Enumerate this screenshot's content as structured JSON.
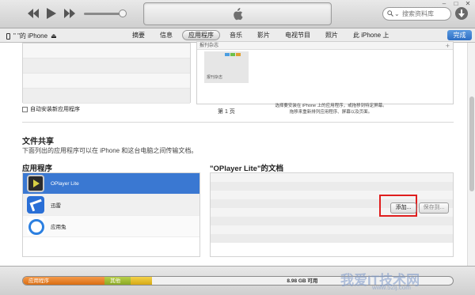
{
  "toolbar": {
    "search_placeholder": "搜索资料库"
  },
  "device_bar": {
    "device_name": "\"     \"的 iPhone",
    "tabs": [
      {
        "label": "摘要"
      },
      {
        "label": "信息"
      },
      {
        "label": "应用程序",
        "active": true
      },
      {
        "label": "音乐"
      },
      {
        "label": "影片"
      },
      {
        "label": "电视节目"
      },
      {
        "label": "照片"
      },
      {
        "label": "此 iPhone 上"
      }
    ],
    "done_label": "完成"
  },
  "apps_section": {
    "auto_install_label": "自动安装新应用程序",
    "panel_header": "报刊杂志",
    "thumb_label": "报刊杂志",
    "page_label": "第 1 页",
    "hint_line1": "选择要安装在 iPhone 上的应用程序，或拖移到特定屏幕。",
    "hint_line2": "拖移来重新排列应用程序、屏幕以及页面。"
  },
  "file_sharing": {
    "title": "文件共享",
    "description": "下面列出的应用程序可以在 iPhone 和这台电脑之间传输文档。",
    "apps_heading": "应用程序",
    "docs_heading": "\"OPlayer Lite\"的文档",
    "apps": [
      {
        "name": "OPlayer Lite",
        "icon": "oplayer-icon",
        "selected": true
      },
      {
        "name": "迅雷",
        "icon": "xunlei-icon"
      },
      {
        "name": "应用兔",
        "icon": "yingyongtu-icon"
      }
    ],
    "add_button": "添加...",
    "save_button": "保存到..."
  },
  "capacity": {
    "apps_label": "应用程序",
    "other_label": "其他",
    "free_label": "8.98 GB 可用",
    "apps_fraction": 0.19,
    "other_fraction": 0.06,
    "yellow_fraction": 0.05,
    "colors": {
      "apps": "#e07d22",
      "other": "#9cba30",
      "yellow": "#e5bd26"
    }
  },
  "watermark": {
    "text": "我爱IT技术网",
    "domain": "www.52ij.com"
  },
  "accent_color": "#3a78d2"
}
